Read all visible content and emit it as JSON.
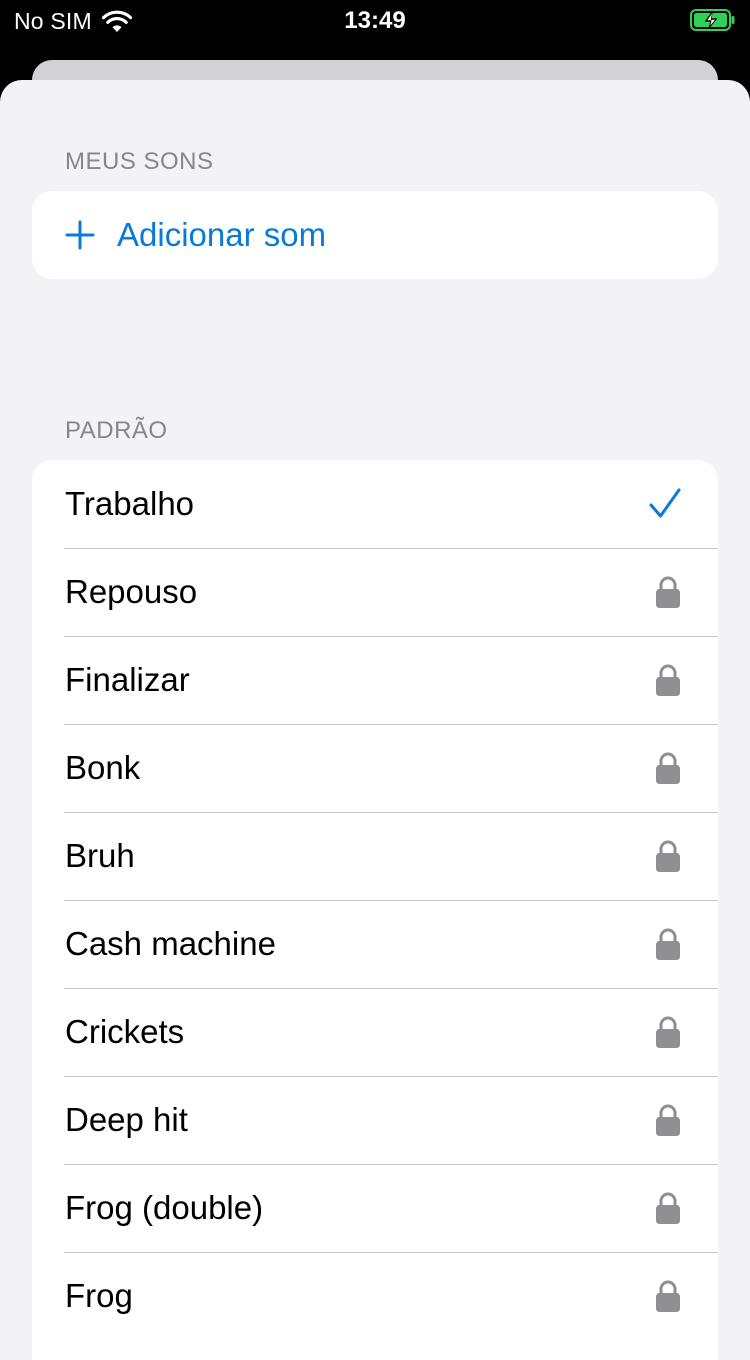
{
  "status_bar": {
    "carrier": "No SIM",
    "time": "13:49",
    "wifi_icon": "wifi-icon",
    "battery_icon": "battery-charging-icon",
    "battery_color": "#30d158"
  },
  "my_sounds": {
    "header": "MEUS SONS",
    "add_label": "Adicionar som",
    "add_icon": "plus-icon"
  },
  "default_sounds": {
    "header": "PADRÃO",
    "items": [
      {
        "label": "Trabalho",
        "state": "selected",
        "icon": "checkmark-icon"
      },
      {
        "label": "Repouso",
        "state": "locked",
        "icon": "lock-icon"
      },
      {
        "label": "Finalizar",
        "state": "locked",
        "icon": "lock-icon"
      },
      {
        "label": "Bonk",
        "state": "locked",
        "icon": "lock-icon"
      },
      {
        "label": "Bruh",
        "state": "locked",
        "icon": "lock-icon"
      },
      {
        "label": "Cash machine",
        "state": "locked",
        "icon": "lock-icon"
      },
      {
        "label": "Crickets",
        "state": "locked",
        "icon": "lock-icon"
      },
      {
        "label": "Deep hit",
        "state": "locked",
        "icon": "lock-icon"
      },
      {
        "label": "Frog (double)",
        "state": "locked",
        "icon": "lock-icon"
      },
      {
        "label": "Frog",
        "state": "locked",
        "icon": "lock-icon"
      }
    ]
  },
  "colors": {
    "accent": "#0a7ad8",
    "lock": "#8e8e93",
    "background": "#f2f2f7"
  }
}
